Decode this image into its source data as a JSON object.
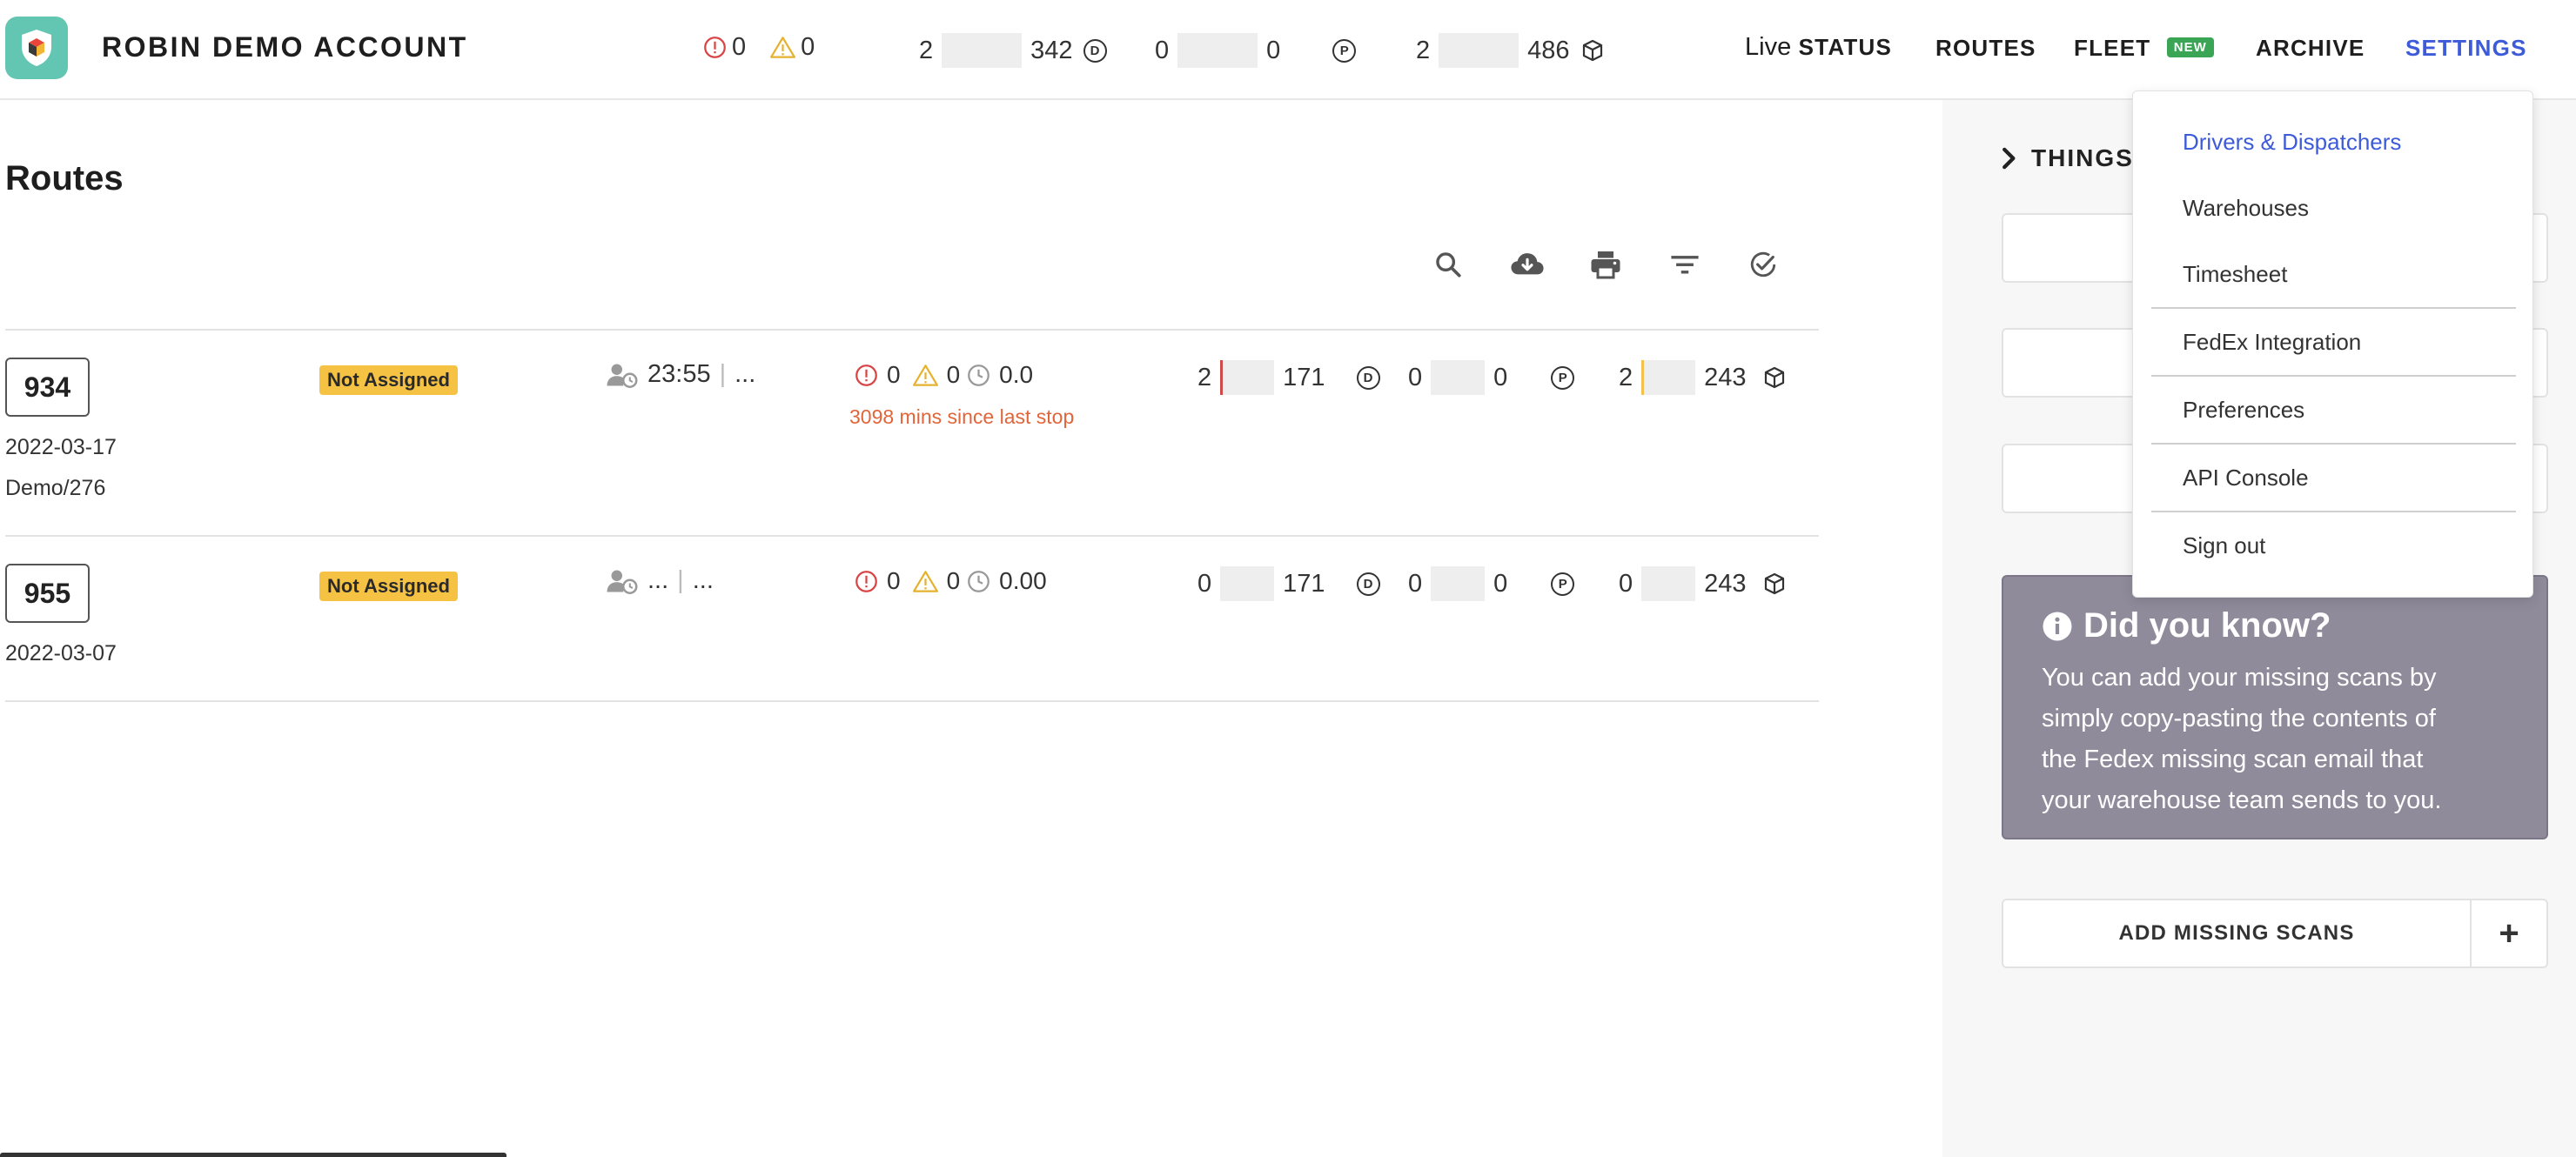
{
  "header": {
    "account_name": "ROBIN DEMO ACCOUNT",
    "error_count": "0",
    "warning_count": "0",
    "stats": {
      "delivery_start": "2",
      "delivery_end": "342",
      "delivery_icon": "D",
      "pickup_start": "0",
      "pickup_end": "0",
      "pickup_icon": "P",
      "package_start": "2",
      "package_end": "486"
    },
    "nav": {
      "live_prefix": "Live",
      "status": "STATUS",
      "routes": "ROUTES",
      "fleet": "FLEET",
      "fleet_badge": "NEW",
      "archive": "ARCHIVE",
      "settings": "SETTINGS"
    }
  },
  "main": {
    "title": "Routes",
    "toolbar": [
      "search-icon",
      "cloud-download-icon",
      "print-icon",
      "filter-icon",
      "check-circle-icon"
    ],
    "routes": [
      {
        "id": "934",
        "date": "2022-03-17",
        "ref": "Demo/276",
        "status": "Not Assigned",
        "time_start": "23:55",
        "time_end": "...",
        "errors": "0",
        "warnings": "0",
        "duration": "0.0",
        "since_last_stop": "3098 mins since last stop",
        "delivery_done": "2",
        "delivery_total": "171",
        "delivery_icon": "D",
        "pickup_done": "0",
        "pickup_total": "0",
        "pickup_icon": "P",
        "package_done": "2",
        "package_total": "243"
      },
      {
        "id": "955",
        "date": "2022-03-07",
        "status": "Not Assigned",
        "time_start": "...",
        "time_end": "...",
        "errors": "0",
        "warnings": "0",
        "duration": "0.00",
        "delivery_done": "0",
        "delivery_total": "171",
        "delivery_icon": "D",
        "pickup_done": "0",
        "pickup_total": "0",
        "pickup_icon": "P",
        "package_done": "0",
        "package_total": "243"
      }
    ]
  },
  "panel": {
    "things_label": "THINGS",
    "did_you_know_title": "Did you know?",
    "did_you_know_lines": [
      "You can add your missing scans by",
      "simply copy-pasting the contents of",
      "the Fedex missing scan email that",
      "your warehouse team sends to you."
    ],
    "add_missing_scans": "ADD MISSING SCANS",
    "add_icon": "+"
  },
  "settings_menu": {
    "items": [
      "Drivers & Dispatchers",
      "Warehouses",
      "Timesheet",
      "FedEx Integration",
      "Preferences",
      "API Console",
      "Sign out"
    ],
    "active_index": 0
  },
  "colors": {
    "accent": "#3d5bd9",
    "logo_bg": "#63c6b2",
    "status_badge": "#f6c243",
    "new_badge": "#3aa655",
    "since_text": "#e0653a",
    "did_you_know_bg": "#8f8b9b",
    "error_red": "#d94545",
    "warning_yellow": "#e5b230"
  }
}
